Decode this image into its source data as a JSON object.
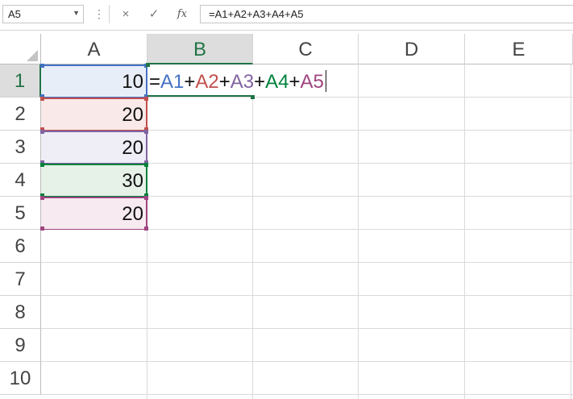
{
  "name_box": {
    "value": "A5"
  },
  "formula_bar": {
    "dots": "⋮",
    "cancel_icon": "×",
    "enter_icon": "✓",
    "fx_label": "fx",
    "text": "=A1+A2+A3+A4+A5"
  },
  "columns": [
    {
      "label": "A",
      "active": false
    },
    {
      "label": "B",
      "active": true
    },
    {
      "label": "C",
      "active": false
    },
    {
      "label": "D",
      "active": false
    },
    {
      "label": "E",
      "active": false
    }
  ],
  "rows": [
    "1",
    "2",
    "3",
    "4",
    "5",
    "6",
    "7",
    "8",
    "9",
    "10"
  ],
  "active_row": "1",
  "cells": {
    "A1": "10",
    "A2": "20",
    "A3": "20",
    "A4": "30",
    "A5": "20"
  },
  "edit_cell": {
    "ref": "B1",
    "parts": [
      {
        "text": "=",
        "color": "#111111"
      },
      {
        "text": "A1",
        "color": "#4472c4"
      },
      {
        "text": "+",
        "color": "#111111"
      },
      {
        "text": "A2",
        "color": "#c0504d"
      },
      {
        "text": "+",
        "color": "#111111"
      },
      {
        "text": "A3",
        "color": "#8064a2"
      },
      {
        "text": "+",
        "color": "#111111"
      },
      {
        "text": "A4",
        "color": "#00823b"
      },
      {
        "text": "+",
        "color": "#111111"
      },
      {
        "text": "A5",
        "color": "#a0457f"
      }
    ]
  },
  "reference_colors": {
    "A1": {
      "border": "#4472c4",
      "fill": "#e8eef8"
    },
    "A2": {
      "border": "#c0504d",
      "fill": "#fae9e9"
    },
    "A3": {
      "border": "#8064a2",
      "fill": "#efedf6"
    },
    "A4": {
      "border": "#00823b",
      "fill": "#e6f1e8"
    },
    "A5": {
      "border": "#a0457f",
      "fill": "#f7eaf1"
    }
  },
  "accent": "#217346"
}
